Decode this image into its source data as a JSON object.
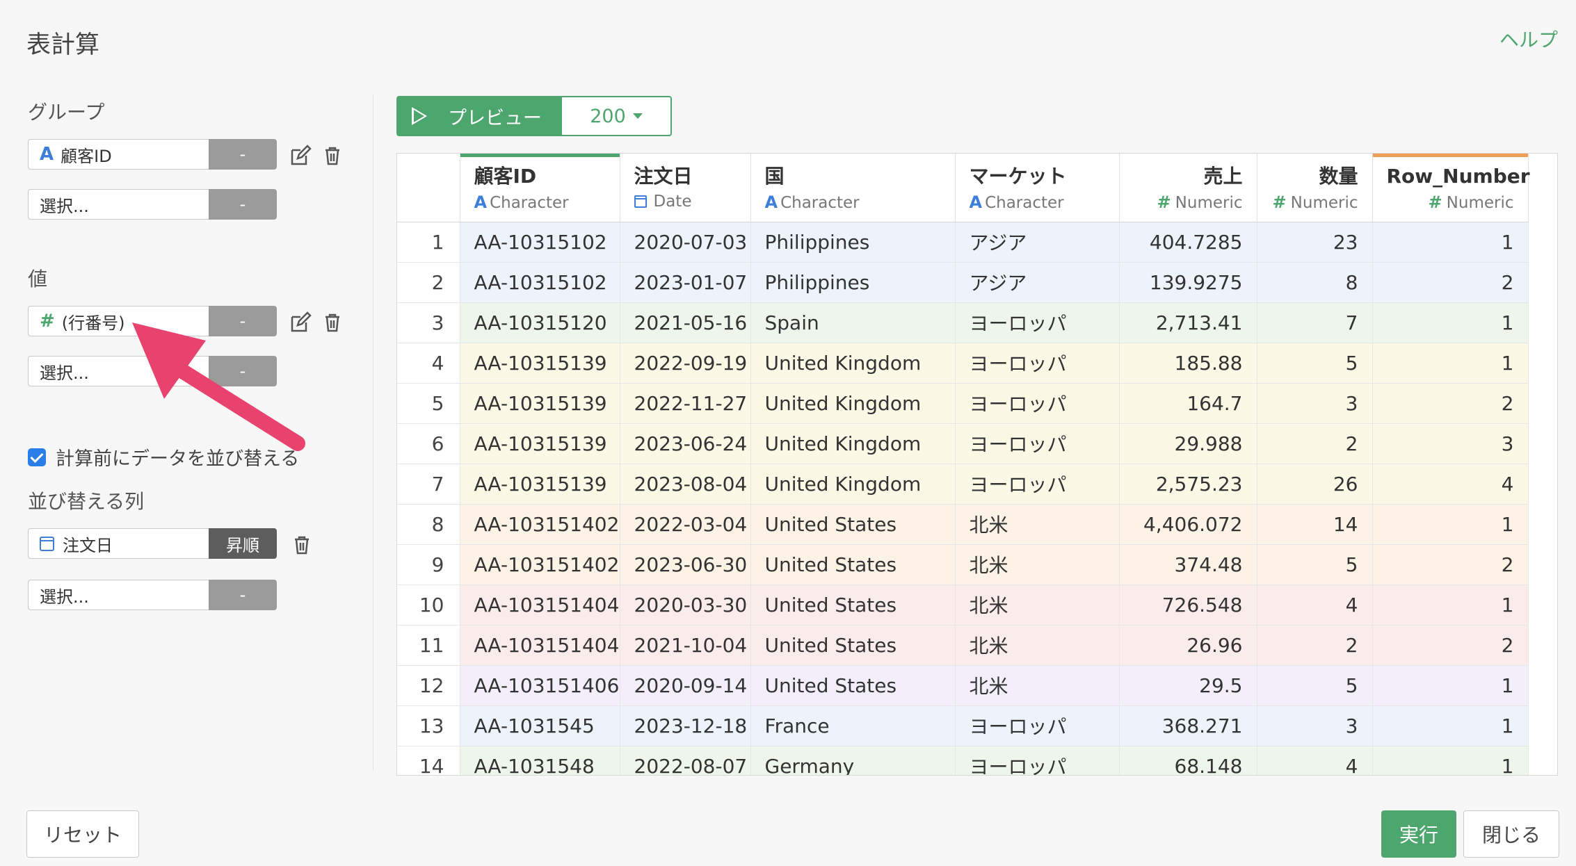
{
  "dialog": {
    "title": "表計算",
    "help": "ヘルプ"
  },
  "group": {
    "label": "グループ",
    "field1": {
      "value": "顧客ID",
      "type_icon": "A",
      "btn": "-"
    },
    "field2": {
      "placeholder": "選択...",
      "btn": "-"
    }
  },
  "value": {
    "label": "値",
    "field1": {
      "value": "(行番号)",
      "type_icon": "#",
      "btn": "-"
    },
    "field2": {
      "placeholder": "選択...",
      "btn": "-"
    }
  },
  "sort": {
    "checkbox_label": "計算前にデータを並び替える",
    "checked": true,
    "label": "並び替える列",
    "field1": {
      "value": "注文日",
      "btn": "昇順"
    },
    "field2": {
      "placeholder": "選択...",
      "btn": "-"
    }
  },
  "preview": {
    "label": "プレビュー",
    "count": "200"
  },
  "table": {
    "columns": [
      {
        "name": "顧客ID",
        "type": "Character",
        "icon": "A"
      },
      {
        "name": "注文日",
        "type": "Date",
        "icon": "date"
      },
      {
        "name": "国",
        "type": "Character",
        "icon": "A"
      },
      {
        "name": "マーケット",
        "type": "Character",
        "icon": "A"
      },
      {
        "name": "売上",
        "type": "Numeric",
        "icon": "#"
      },
      {
        "name": "数量",
        "type": "Numeric",
        "icon": "#"
      },
      {
        "name": "Row_Number",
        "type": "Numeric",
        "icon": "#"
      }
    ],
    "rows": [
      [
        "1",
        "AA-10315102",
        "2020-07-03",
        "Philippines",
        "アジア",
        "404.7285",
        "23",
        "1"
      ],
      [
        "2",
        "AA-10315102",
        "2023-01-07",
        "Philippines",
        "アジア",
        "139.9275",
        "8",
        "2"
      ],
      [
        "3",
        "AA-10315120",
        "2021-05-16",
        "Spain",
        "ヨーロッパ",
        "2,713.41",
        "7",
        "1"
      ],
      [
        "4",
        "AA-10315139",
        "2022-09-19",
        "United Kingdom",
        "ヨーロッパ",
        "185.88",
        "5",
        "1"
      ],
      [
        "5",
        "AA-10315139",
        "2022-11-27",
        "United Kingdom",
        "ヨーロッパ",
        "164.7",
        "3",
        "2"
      ],
      [
        "6",
        "AA-10315139",
        "2023-06-24",
        "United Kingdom",
        "ヨーロッパ",
        "29.988",
        "2",
        "3"
      ],
      [
        "7",
        "AA-10315139",
        "2023-08-04",
        "United Kingdom",
        "ヨーロッパ",
        "2,575.23",
        "26",
        "4"
      ],
      [
        "8",
        "AA-103151402",
        "2022-03-04",
        "United States",
        "北米",
        "4,406.072",
        "14",
        "1"
      ],
      [
        "9",
        "AA-103151402",
        "2023-06-30",
        "United States",
        "北米",
        "374.48",
        "5",
        "2"
      ],
      [
        "10",
        "AA-103151404",
        "2020-03-30",
        "United States",
        "北米",
        "726.548",
        "4",
        "1"
      ],
      [
        "11",
        "AA-103151404",
        "2021-10-04",
        "United States",
        "北米",
        "26.96",
        "2",
        "2"
      ],
      [
        "12",
        "AA-103151406",
        "2020-09-14",
        "United States",
        "北米",
        "29.5",
        "5",
        "1"
      ],
      [
        "13",
        "AA-1031545",
        "2023-12-18",
        "France",
        "ヨーロッパ",
        "368.271",
        "3",
        "1"
      ],
      [
        "14",
        "AA-1031548",
        "2022-08-07",
        "Germany",
        "ヨーロッパ",
        "68.148",
        "4",
        "1"
      ]
    ],
    "row_colors": [
      "#edf3fb",
      "#edf3fb",
      "#eef6ec",
      "#fbf8e6",
      "#fbf8e6",
      "#fbf8e6",
      "#fbf8e6",
      "#fcf3e6",
      "#fcf3e6",
      "#fbecec",
      "#fbecec",
      "#f3effa",
      "#edf3fb",
      "#eef6ec"
    ]
  },
  "footer": {
    "reset": "リセット",
    "run": "実行",
    "close": "閉じる"
  },
  "colors": {
    "accent": "#4ea66f",
    "annotation_arrow": "#e8426f"
  }
}
